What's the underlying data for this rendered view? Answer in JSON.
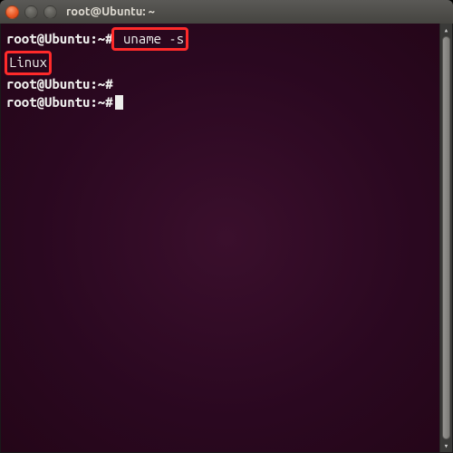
{
  "window": {
    "title": "root@Ubuntu: ~"
  },
  "terminal": {
    "lines": [
      {
        "prompt": "root@Ubuntu:~#",
        "command": " uname -s"
      },
      {
        "output": "Linux"
      },
      {
        "prompt": "root@Ubuntu:~#",
        "command": ""
      },
      {
        "prompt": "root@Ubuntu:~#",
        "command": ""
      }
    ]
  },
  "highlights": {
    "command_highlighted": "uname -s",
    "output_highlighted": "Linux"
  }
}
